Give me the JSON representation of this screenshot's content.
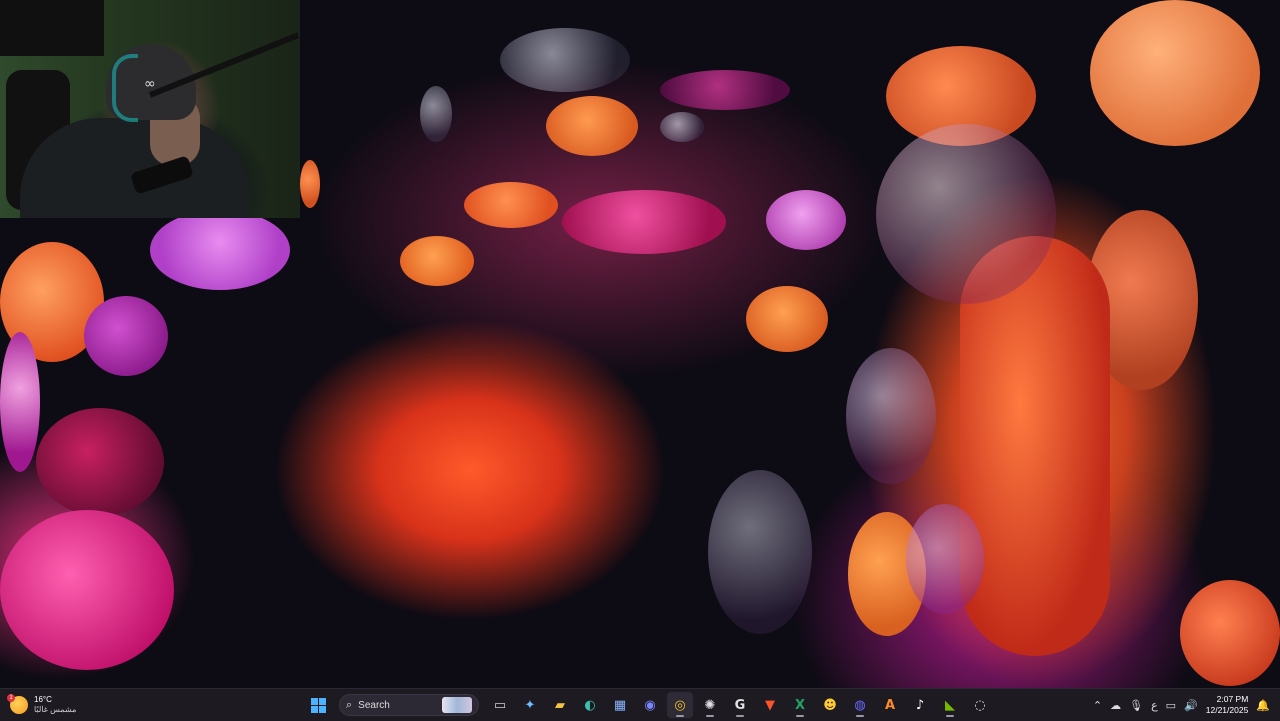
{
  "desktop": {
    "wallpaper": "bloom-abstract-wallpaper"
  },
  "webcam": {
    "beanie_logo": "∞"
  },
  "taskbar": {
    "weather": {
      "badge": "1",
      "temperature": "16°C",
      "condition": "مشمس غالبًا"
    },
    "search": {
      "label": "Search"
    },
    "apps": [
      {
        "name": "start",
        "glyph": ""
      },
      {
        "name": "task-view",
        "glyph": "▭"
      },
      {
        "name": "copilot",
        "glyph": "✦"
      },
      {
        "name": "file-explorer",
        "glyph": "▰"
      },
      {
        "name": "edge",
        "glyph": "◐"
      },
      {
        "name": "microsoft-store",
        "glyph": "▦"
      },
      {
        "name": "discord",
        "glyph": "◉"
      },
      {
        "name": "chrome",
        "glyph": "◎"
      },
      {
        "name": "chatgpt",
        "glyph": "✺"
      },
      {
        "name": "app-g",
        "glyph": "G"
      },
      {
        "name": "brave",
        "glyph": "▼"
      },
      {
        "name": "excel",
        "glyph": "X"
      },
      {
        "name": "app-emoji",
        "glyph": "☻"
      },
      {
        "name": "app-pay",
        "glyph": "◍"
      },
      {
        "name": "app-a",
        "glyph": "A"
      },
      {
        "name": "tiktok",
        "glyph": "♪"
      },
      {
        "name": "nvidia",
        "glyph": "◣"
      },
      {
        "name": "obs",
        "glyph": "◌"
      }
    ],
    "tray": {
      "chevron": "⌃",
      "language": "ع",
      "clock_time": "2:07 PM",
      "clock_date": "12/21/2025"
    }
  }
}
